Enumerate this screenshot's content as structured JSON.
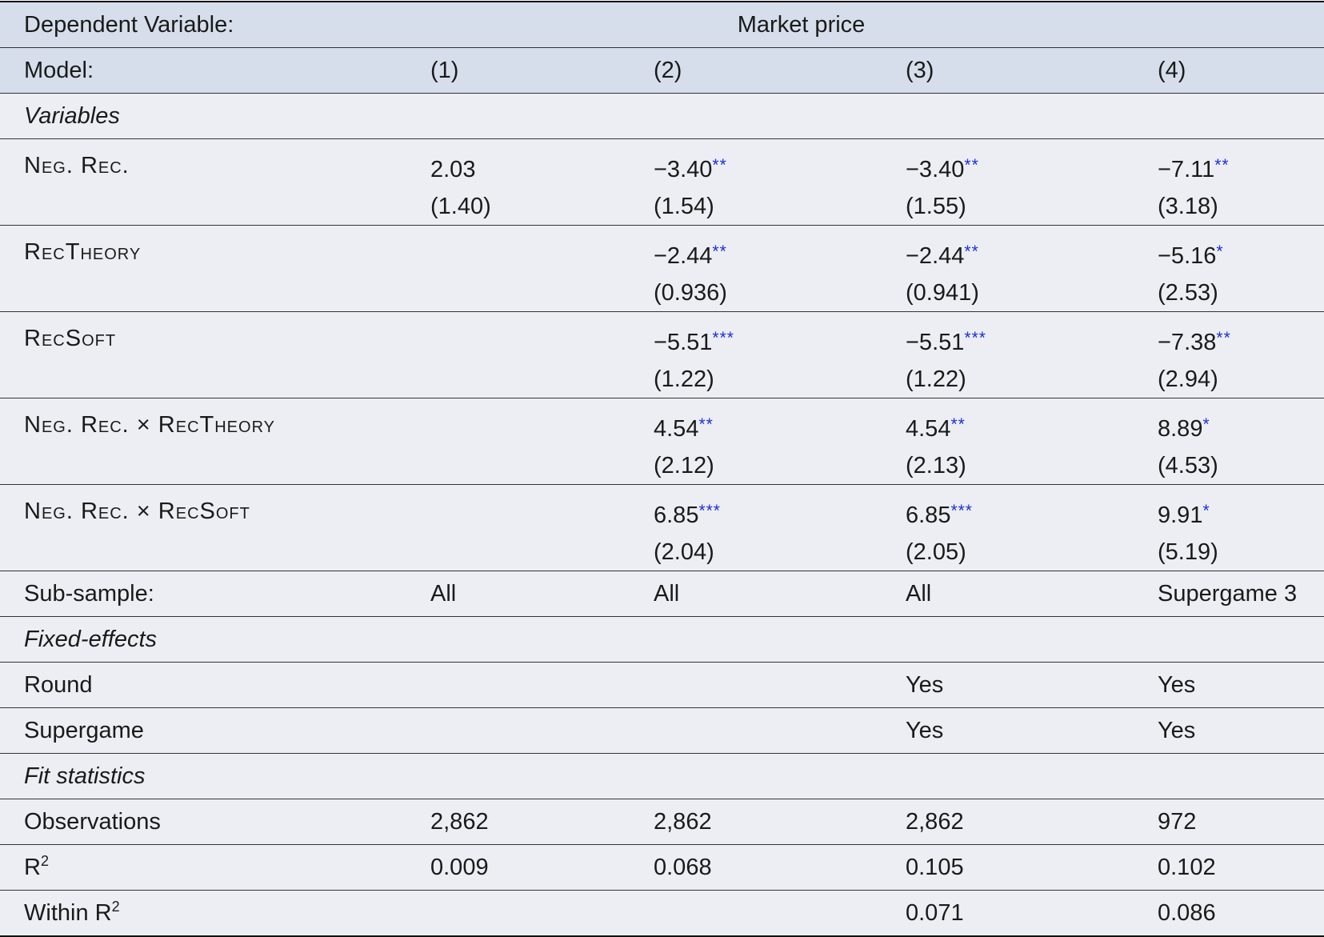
{
  "header": {
    "dep_label": "Dependent Variable:",
    "dep_value": "Market price",
    "model_label": "Model:",
    "models": [
      "(1)",
      "(2)",
      "(3)",
      "(4)"
    ]
  },
  "sections": {
    "variables": "Variables",
    "fixed_effects": "Fixed-effects",
    "fit": "Fit statistics"
  },
  "variables": [
    {
      "name": "Neg. Rec.",
      "coef": [
        "2.03",
        "−3.40",
        "−3.40",
        "−7.11"
      ],
      "stars": [
        "",
        "**",
        "**",
        "**"
      ],
      "se": [
        "(1.40)",
        "(1.54)",
        "(1.55)",
        "(3.18)"
      ]
    },
    {
      "name": "RecTheory",
      "coef": [
        "",
        "−2.44",
        "−2.44",
        "−5.16"
      ],
      "stars": [
        "",
        "**",
        "**",
        "*"
      ],
      "se": [
        "",
        "(0.936)",
        "(0.941)",
        "(2.53)"
      ]
    },
    {
      "name": "RecSoft",
      "coef": [
        "",
        "−5.51",
        "−5.51",
        "−7.38"
      ],
      "stars": [
        "",
        "***",
        "***",
        "**"
      ],
      "se": [
        "",
        "(1.22)",
        "(1.22)",
        "(2.94)"
      ]
    },
    {
      "name": "Neg. Rec. × RecTheory",
      "coef": [
        "",
        "4.54",
        "4.54",
        "8.89"
      ],
      "stars": [
        "",
        "**",
        "**",
        "*"
      ],
      "se": [
        "",
        "(2.12)",
        "(2.13)",
        "(4.53)"
      ]
    },
    {
      "name": "Neg. Rec. × RecSoft",
      "coef": [
        "",
        "6.85",
        "6.85",
        "9.91"
      ],
      "stars": [
        "",
        "***",
        "***",
        "*"
      ],
      "se": [
        "",
        "(2.04)",
        "(2.05)",
        "(5.19)"
      ]
    }
  ],
  "subsample": {
    "label": "Sub-sample:",
    "values": [
      "All",
      "All",
      "All",
      "Supergame 3"
    ]
  },
  "fixed_effects": [
    {
      "label": "Round",
      "values": [
        "",
        "",
        "Yes",
        "Yes"
      ]
    },
    {
      "label": "Supergame",
      "values": [
        "",
        "",
        "Yes",
        "Yes"
      ]
    }
  ],
  "fit": {
    "observations": {
      "label": "Observations",
      "values": [
        "2,862",
        "2,862",
        "2,862",
        "972"
      ]
    },
    "r2": {
      "label": "R",
      "sup": "2",
      "values": [
        "0.009",
        "0.068",
        "0.105",
        "0.102"
      ]
    },
    "within_r2": {
      "label": "Within R",
      "sup": "2",
      "values": [
        "",
        "",
        "0.071",
        "0.086"
      ]
    }
  }
}
